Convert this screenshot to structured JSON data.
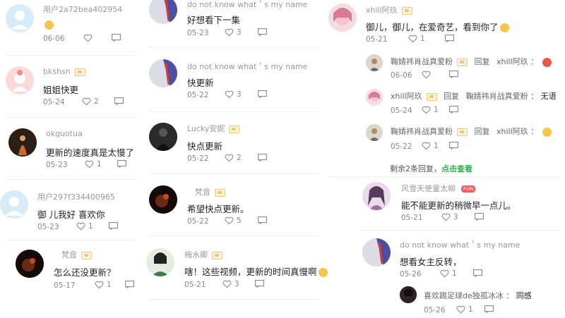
{
  "icons": {
    "like": "heart-outline-icon",
    "reply": "comment-bubble-icon",
    "badge": "vip-badge-icon",
    "emoji": "smiley-emoji-icon"
  },
  "colors": {
    "accent_link": "#2cb34a",
    "muted": "#999999",
    "badge": "#e8c98a"
  },
  "col1": [
    {
      "user": "用户2a72bea402954",
      "text": "",
      "date": "06-06",
      "likes": ""
    },
    {
      "user": "bkshsn",
      "text": "姐姐快更",
      "date": "05-24",
      "likes": "2"
    },
    {
      "user": "okguotua",
      "text": "更新的速度真是太慢了",
      "date": "05-23",
      "likes": "1"
    },
    {
      "user": "用户297f334400965",
      "text": "御 儿我好 喜欢你",
      "date": "05-23",
      "likes": "1"
    },
    {
      "user": "梵音",
      "text": "怎么还没更新？",
      "date": "05-17",
      "likes": "1"
    }
  ],
  "col2": [
    {
      "user": "do not know what＇s my name",
      "text": "好想看下一集",
      "date": "05-23",
      "likes": "3"
    },
    {
      "user": "do not know what＇s my name",
      "text": "快更新",
      "date": "05-22",
      "likes": "3"
    },
    {
      "user": "Lucky安妮",
      "text": "快点更新",
      "date": "05-22",
      "likes": "2"
    },
    {
      "user": "梵音",
      "text": "希望快点更新。",
      "date": "05-22",
      "likes": "5"
    },
    {
      "user": "梅水卿",
      "text": "嗐！这些视频，更新的时间真慢啊",
      "date": "05-21",
      "likes": "3"
    }
  ],
  "col3": {
    "main1": {
      "user": "xhill阿玖",
      "text": "御儿，御儿，在爱奇艺，看到你了",
      "date": "05-21",
      "likes": "1"
    },
    "replies": [
      {
        "user": "鞠婧祎肖战真爱粉",
        "reply_word": "回复",
        "target": "xhill阿玖",
        "text": "",
        "date": "06-06",
        "likes": ""
      },
      {
        "user": "xhill阿玖",
        "reply_word": "回复",
        "target": "鞠婧祎肖战真爱粉",
        "text": "无语",
        "date": "05-24",
        "likes": "1"
      },
      {
        "user": "鞠婧祎肖战真爱粉",
        "reply_word": "回复",
        "target": "xhill阿玖",
        "text": "",
        "date": "05-22",
        "likes": "1"
      }
    ],
    "more_prefix": "剩余2条回复，",
    "more_link": "点击查看",
    "main2": {
      "user": "风雪天使童太柳",
      "fun_badge": "FUN",
      "text": "能不能更新的稍微早一点儿。",
      "date": "05-21",
      "likes": "3"
    },
    "main3": {
      "user": "do not know what＇s my name",
      "text": "想看女主反转，",
      "date": "05-26",
      "likes": "1"
    },
    "sub3": {
      "user": "喜欢踢足球de独孤冰冰",
      "sep": "：",
      "text": "同感",
      "date": "05-26",
      "likes": "1"
    }
  }
}
